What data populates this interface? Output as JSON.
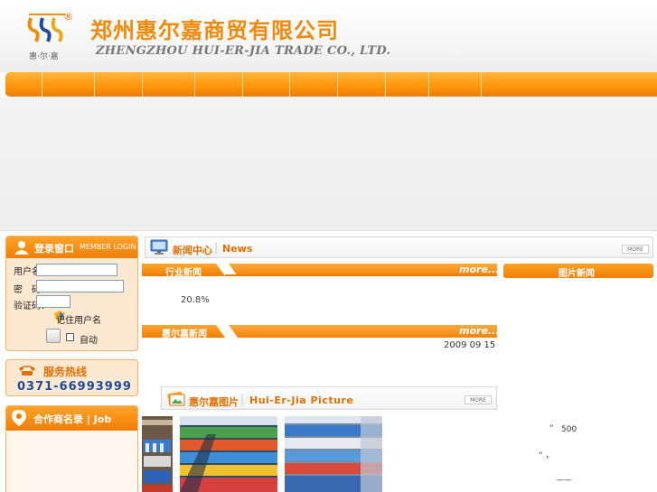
{
  "header": {
    "company_cn": "郑州惠尔嘉商贸有限公司",
    "company_en": "ZHENGZHOU HUI-ER-JIA TRADE CO., LTD.",
    "logo_sub": "惠·尔·嘉",
    "registered_mark": "®"
  },
  "nav": {
    "item_count": 11
  },
  "login": {
    "title_cn": "登录窗口",
    "title_en": "MEMBER LOGIN",
    "username_label": "用户名：",
    "password_label": "密　码：",
    "code_label": "验证码：",
    "remember_label": "记住用户名",
    "auto_label": "自动"
  },
  "hotline": {
    "title": "服务热线",
    "number": "0371-66993999"
  },
  "partners": {
    "title": "合作商名录 | Job"
  },
  "news_center": {
    "title_cn": "新闻中心",
    "title_en": "News",
    "more": "MORE"
  },
  "industry_news": {
    "label": "行业新闻",
    "more": "more...",
    "item": "20.8%"
  },
  "company_news": {
    "label": "惠尔嘉新闻",
    "more": "more...",
    "date": "2009 09 15"
  },
  "pictures": {
    "title_cn": "惠尔嘉图片",
    "title_en": "Hui-Er-Jia Picture",
    "more": "MORE"
  },
  "photo_news": {
    "label": "图片新闻",
    "line1_quote": "“",
    "line1_value": "500",
    "line2": "“ ，",
    "line3": "——"
  },
  "colors": {
    "brand_orange": "#f07e04",
    "brand_blue": "#1f4b9a"
  }
}
